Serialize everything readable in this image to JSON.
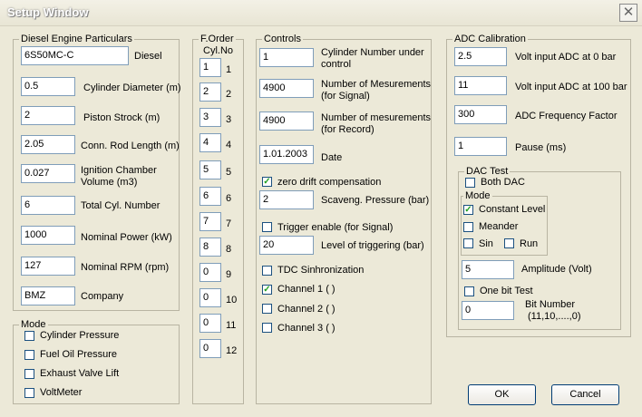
{
  "window": {
    "title": "Setup Window"
  },
  "engine": {
    "legend": "Diesel Engine Particulars",
    "type_value": "6S50MC-C",
    "type_label": "Diesel",
    "fields": [
      {
        "value": "0.5",
        "label": "Cylinder Diameter (m)"
      },
      {
        "value": "2",
        "label": "Piston Strock (m)"
      },
      {
        "value": "2.05",
        "label": "Conn. Rod Length (m)"
      },
      {
        "value": "0.027",
        "label1": "Ignition Chamber",
        "label2": "Volume (m3)"
      },
      {
        "value": "6",
        "label": "Total  Cyl. Number"
      },
      {
        "value": "1000",
        "label": "Nominal Power (kW)"
      },
      {
        "value": "127",
        "label": "Nominal  RPM (rpm)"
      },
      {
        "value": "BMZ",
        "label": "Company"
      }
    ]
  },
  "mode": {
    "legend": "Mode",
    "items": [
      {
        "label": "Cylinder Pressure",
        "checked": false
      },
      {
        "label": "Fuel Oil Pressure",
        "checked": false
      },
      {
        "label": "Exhaust Valve Lift",
        "checked": false
      },
      {
        "label": "VoltMeter",
        "checked": false
      }
    ]
  },
  "forder": {
    "legend": "F.Order",
    "header": "Cyl.No",
    "rows": [
      {
        "value": "1",
        "cyl": "1"
      },
      {
        "value": "2",
        "cyl": "2"
      },
      {
        "value": "3",
        "cyl": "3"
      },
      {
        "value": "4",
        "cyl": "4"
      },
      {
        "value": "5",
        "cyl": "5"
      },
      {
        "value": "6",
        "cyl": "6"
      },
      {
        "value": "7",
        "cyl": "7"
      },
      {
        "value": "8",
        "cyl": "8"
      },
      {
        "value": "0",
        "cyl": "9"
      },
      {
        "value": "0",
        "cyl": "10"
      },
      {
        "value": "0",
        "cyl": "11"
      },
      {
        "value": "0",
        "cyl": "12"
      }
    ]
  },
  "controls": {
    "legend": "Controls",
    "cylinder_value": "1",
    "cylinder_label1": "Cylinder Number under",
    "cylinder_label2": "control",
    "meas_signal_value": "4900",
    "meas_signal_label1": "Number of Mesurements",
    "meas_signal_label2": "(for Signal)",
    "meas_record_value": "4900",
    "meas_record_label1": "Number of mesurements",
    "meas_record_label2": "(for Record)",
    "date_value": "1.01.2003",
    "date_label": "Date",
    "zero_drift_label": "zero drift compensation",
    "zero_drift_checked": true,
    "scaveng_value": "2",
    "scaveng_label": "Scaveng. Pressure (bar)",
    "trigger_label": "Trigger enable (for Signal)",
    "trigger_checked": false,
    "trig_level_value": "20",
    "trig_level_label": "Level of triggering (bar)",
    "tdc_label": "TDC Sinhronization",
    "tdc_checked": false,
    "channels": [
      {
        "label": "Channel 1  (  )",
        "checked": true
      },
      {
        "label": "Channel 2  (  )",
        "checked": false
      },
      {
        "label": "Channel 3  (  )",
        "checked": false
      }
    ]
  },
  "adc": {
    "legend": "ADC Calibration",
    "fields": [
      {
        "value": "2.5",
        "label": "Volt input ADC at 0  bar"
      },
      {
        "value": "11",
        "label": "Volt input ADC at 100 bar"
      },
      {
        "value": "300",
        "label": "ADC Frequency Factor"
      },
      {
        "value": "1",
        "label": "Pause (ms)"
      }
    ],
    "dac": {
      "legend": "DAC  Test",
      "both_label": "Both DAC",
      "both_checked": false,
      "mode_legend": "Mode",
      "constant_label": "Constant Level",
      "constant_checked": true,
      "meander_label": "Meander",
      "meander_checked": false,
      "sin_label": "Sin",
      "sin_checked": false,
      "run_label": "Run",
      "run_checked": false,
      "amplitude_value": "5",
      "amplitude_label": "Amplitude  (Volt)",
      "onebit_label": "One bit Test",
      "onebit_checked": false,
      "bit_value": "0",
      "bit_label1": "Bit Number",
      "bit_label2": "(11,10,....,0)"
    }
  },
  "buttons": {
    "ok": "OK",
    "cancel": "Cancel"
  }
}
